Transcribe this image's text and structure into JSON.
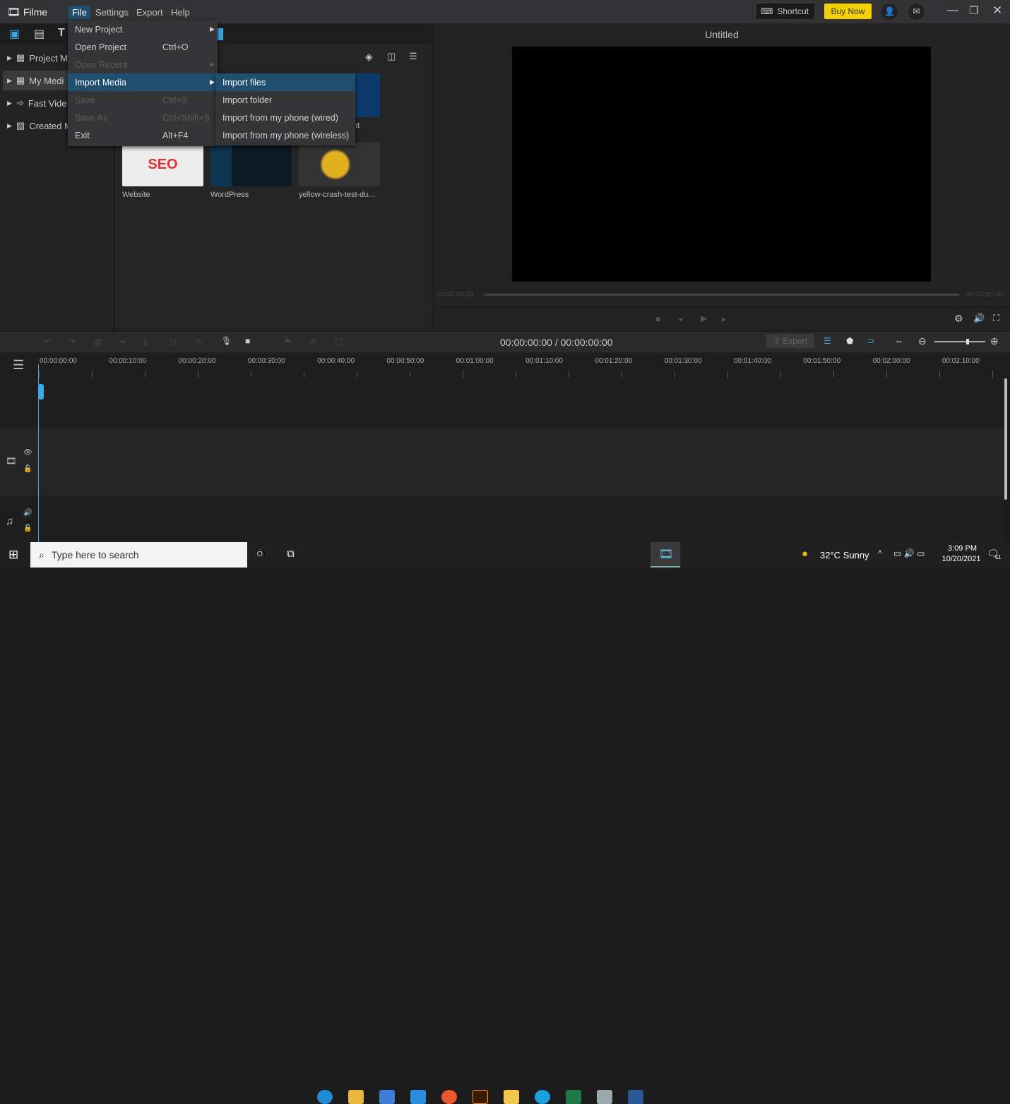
{
  "app": {
    "name": "Filme",
    "menus": [
      "File",
      "Settings",
      "Export",
      "Help"
    ],
    "shortcut_label": "Shortcut",
    "buy_label": "Buy Now",
    "buy_color": "#f5d000"
  },
  "file_menu": [
    {
      "label": "New Project",
      "shortcut": "",
      "submenu": true,
      "disabled": false
    },
    {
      "label": "Open Project",
      "shortcut": "Ctrl+O",
      "submenu": false,
      "disabled": false
    },
    {
      "label": "Open Recent",
      "shortcut": "",
      "submenu": true,
      "disabled": true
    },
    {
      "label": "Import Media",
      "shortcut": "",
      "submenu": true,
      "disabled": false,
      "highlighted": true
    },
    {
      "label": "Save",
      "shortcut": "Ctrl+S",
      "submenu": false,
      "disabled": true
    },
    {
      "label": "Save As",
      "shortcut": "Ctrl+Shift+S",
      "submenu": false,
      "disabled": true
    },
    {
      "label": "Exit",
      "shortcut": "Alt+F4",
      "submenu": false,
      "disabled": false
    }
  ],
  "import_submenu": [
    "Import files",
    "Import folder",
    "Import from my phone (wired)",
    "Import from my phone (wireless)"
  ],
  "sidebar": [
    "Project M",
    "My Medi",
    "Fast Vide",
    "Created M"
  ],
  "media": [
    {
      "label": "nt"
    },
    {
      "label": "Website"
    },
    {
      "label": "WordPress"
    },
    {
      "label": "yellow-crash-test-du..."
    }
  ],
  "preview": {
    "title": "Untitled",
    "time_start": "00:00:00:00",
    "time_end": "00:00:00:00"
  },
  "timeline": {
    "timecode": "00:00:00:00 / 00:00:00:00",
    "export_label": "Export",
    "ticks": [
      "00:00:00:00",
      "00:00:10:00",
      "00:00:20:00",
      "00:00:30:00",
      "00:00:40:00",
      "00:00:50:00",
      "00:01:00:00",
      "00:01:10:00",
      "00:01:20:00",
      "00:01:30:00",
      "00:01:40:00",
      "00:01:50:00",
      "00:02:00:00",
      "00:02:10:00"
    ]
  },
  "taskbar": {
    "search_placeholder": "Type here to search",
    "weather": "32°C  Sunny",
    "time": "3:09 PM",
    "date": "10/20/2021",
    "notifications": "11"
  }
}
